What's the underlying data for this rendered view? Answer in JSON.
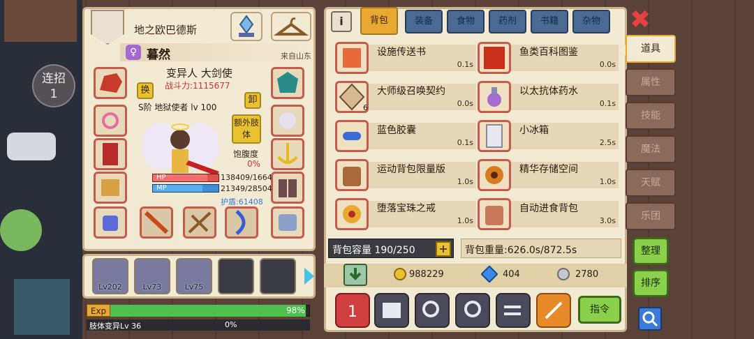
{
  "left_panel": {
    "guild_name": "地之欧巴德斯",
    "player_name": "暮然",
    "origin": "来自山东",
    "job": "变异人 大剑使",
    "power": "战斗力:1115677",
    "swap_label": "换",
    "unload_label": "卸",
    "extra_limb_label": "额外肢体",
    "satiety_label": "饱腹度",
    "satiety_value": "0%",
    "weapon_text": "S阶 地狱使者 lv 100",
    "hp_label": "HP",
    "mp_label": "MP",
    "hp_value": "138409/1664",
    "mp_value": "21349/28504",
    "shield": "护盾:61408",
    "hp_fraction": 0.83,
    "mp_fraction": 0.75
  },
  "party": {
    "members": [
      {
        "level": "Lv202"
      },
      {
        "level": "Lv73"
      },
      {
        "level": "Lv75"
      }
    ],
    "empty_slots": 2
  },
  "exp": {
    "label": "Exp",
    "value": "98%",
    "fraction": 0.98,
    "skill_label": "肢体变异Lv 36",
    "skill_value": "0%"
  },
  "connection": {
    "label": "连招",
    "count": "1"
  },
  "tabs": [
    "背包",
    "装备",
    "食物",
    "药剂",
    "书籍",
    "杂物"
  ],
  "active_tab": "背包",
  "items": [
    {
      "name": "设施传送书",
      "time": "0.1s",
      "icon": "teleport-book-icon"
    },
    {
      "name": "鱼类百科图鉴",
      "time": "0.0s",
      "icon": "fish-encyclopedia-icon"
    },
    {
      "name": "大师级召唤契约",
      "time": "0.0s",
      "count": "6",
      "icon": "summon-contract-icon"
    },
    {
      "name": "以太抗体药水",
      "time": "0.1s",
      "icon": "potion-icon"
    },
    {
      "name": "蓝色胶囊",
      "time": "0.1s",
      "icon": "capsule-icon"
    },
    {
      "name": "小冰箱",
      "time": "2.5s",
      "icon": "fridge-icon"
    },
    {
      "name": "运动背包限量版",
      "time": "1.0s",
      "icon": "backpack-icon"
    },
    {
      "name": "精华存储空间",
      "time": "1.0s",
      "icon": "ring-icon"
    },
    {
      "name": "堕落宝珠之戒",
      "time": "1.0s",
      "icon": "ring-icon"
    },
    {
      "name": "自动进食背包",
      "time": "3.0s",
      "icon": "backpack-icon"
    }
  ],
  "bag": {
    "capacity": "背包容量 190/250",
    "plus": "+",
    "weight": "背包重量:626.0s/872.5s"
  },
  "currency": {
    "gold": "988229",
    "diamond": "404",
    "silver": "2780"
  },
  "actions": {
    "command_label": "指令"
  },
  "side_tabs": [
    "道具",
    "属性",
    "技能",
    "魔法",
    "天赋",
    "乐团"
  ],
  "active_side": "道具",
  "buttons": {
    "organize": "整理",
    "sort": "排序",
    "close": "✖"
  },
  "colors": {
    "accent": "#e9a832",
    "panel": "#f3ead4",
    "item_border": "#c35c4c",
    "tab_blue": "#4a6a92",
    "green_button": "#8ad04a"
  }
}
